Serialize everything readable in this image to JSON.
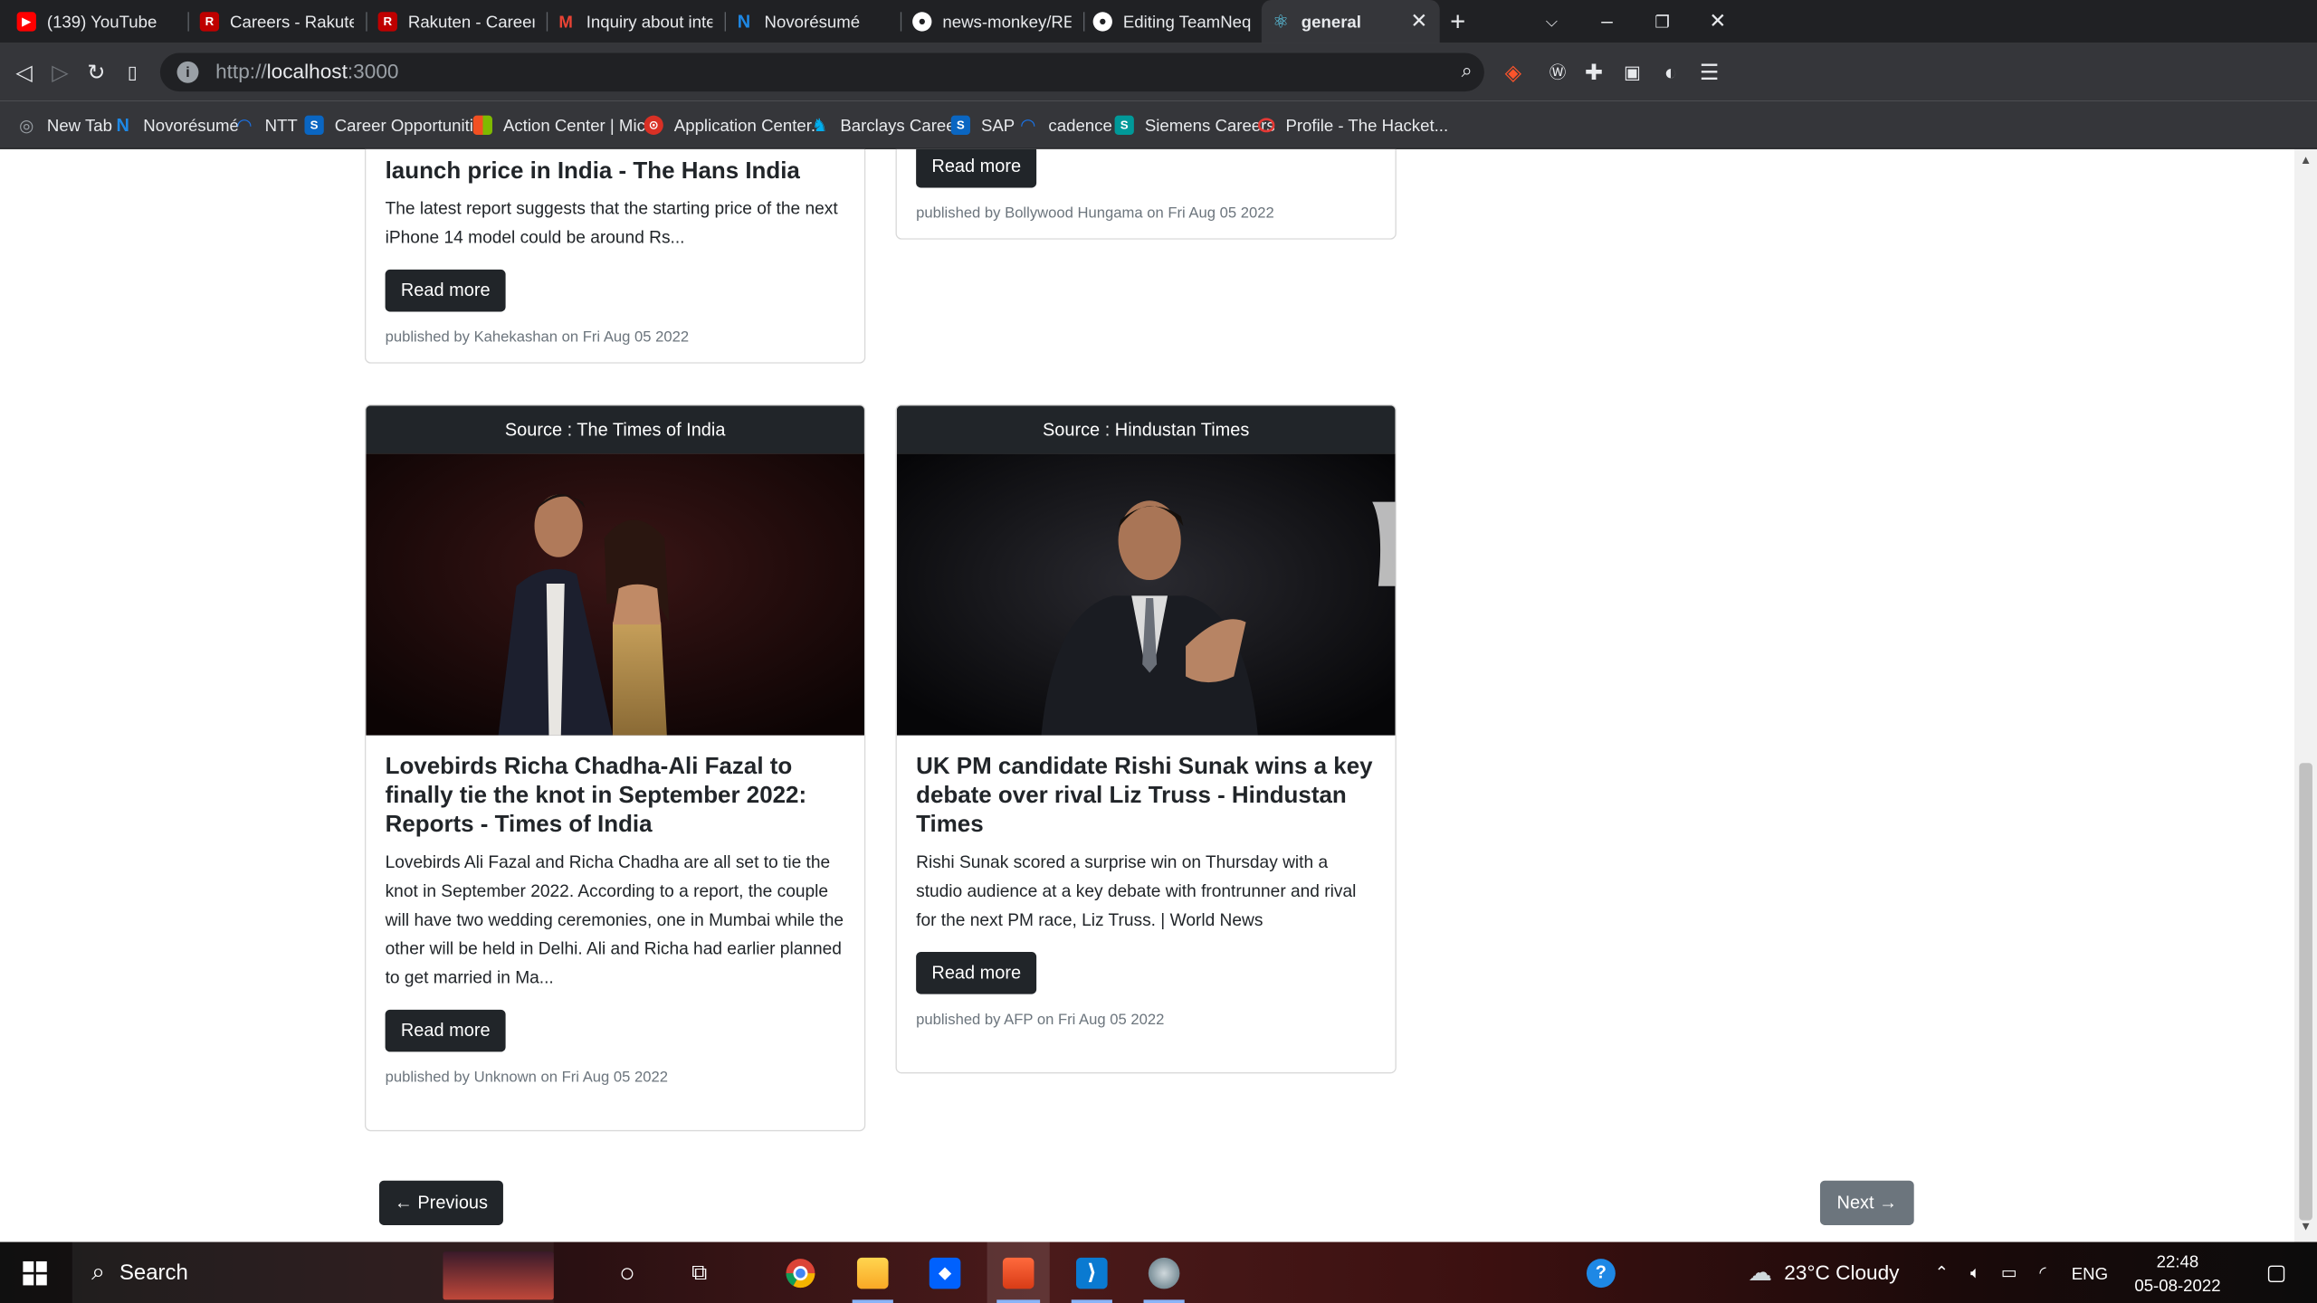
{
  "browser": {
    "tabs": [
      {
        "title": "(139) YouTube",
        "color": "#ff0000",
        "glyph": "▶"
      },
      {
        "title": "Careers - Rakuten India",
        "color": "#bf0000",
        "glyph": "R"
      },
      {
        "title": "Rakuten - Careers",
        "color": "#bf0000",
        "glyph": "R"
      },
      {
        "title": "Inquiry about internship",
        "color": "#ea4335",
        "glyph": "M"
      },
      {
        "title": "Novorésumé",
        "color": "#1e88e5",
        "glyph": "N"
      },
      {
        "title": "news-monkey/README",
        "color": "#ffffff",
        "glyph": "●"
      },
      {
        "title": "Editing TeamNequit/RE",
        "color": "#ffffff",
        "glyph": "●"
      },
      {
        "title": "general",
        "color": "#61dafb",
        "glyph": "⚛"
      }
    ],
    "active_tab_close": "✕",
    "new_tab": "+",
    "url_scheme": "http://",
    "url_host": "localhost",
    "url_port": ":3000",
    "bookmarks": [
      {
        "label": "New Tab",
        "color": "#9aa0a6",
        "glyph": "◎"
      },
      {
        "label": "Novorésumé",
        "color": "#1e88e5",
        "glyph": "N"
      },
      {
        "label": "NTT",
        "color": "#1a73e8",
        "glyph": "◠"
      },
      {
        "label": "Career Opportuniti...",
        "color": "#0a66c2",
        "glyph": "S"
      },
      {
        "label": "Action Center | Mic...",
        "color": "#f25022",
        "glyph": "▦"
      },
      {
        "label": "Application Center...",
        "color": "#d93025",
        "glyph": "⊙"
      },
      {
        "label": "Barclays Careers",
        "color": "#00aeef",
        "glyph": "♞"
      },
      {
        "label": "SAP",
        "color": "#0a66c2",
        "glyph": "S"
      },
      {
        "label": "cadence",
        "color": "#1a73e8",
        "glyph": "◠"
      },
      {
        "label": "Siemens Careers",
        "color": "#009999",
        "glyph": "S"
      },
      {
        "label": "Profile - The Hacket...",
        "color": "#e53935",
        "glyph": "◯"
      }
    ]
  },
  "cards_top": [
    {
      "title_tail": "launch price in India - The Hans India",
      "desc": "The latest report suggests that the starting price of the next iPhone 14 model could be around Rs...",
      "read_more": "Read more",
      "meta": "published by Kahekashan on Fri Aug 05 2022"
    },
    {
      "read_more": "Read more",
      "meta": "published by Bollywood Hungama on Fri Aug 05 2022"
    }
  ],
  "cards": [
    {
      "source": "Source : The Times of India",
      "title": "Lovebirds Richa Chadha-Ali Fazal to finally tie the knot in September 2022: Reports - Times of India",
      "desc": "Lovebirds Ali Fazal and Richa Chadha are all set to tie the knot in September 2022. According to a report, the couple will have two wedding ceremonies, one in Mumbai while the other will be held in Delhi. Ali and Richa had earlier planned to get married in Ma...",
      "read_more": "Read more",
      "meta": "published by Unknown on Fri Aug 05 2022"
    },
    {
      "source": "Source : Hindustan Times",
      "title": "UK PM candidate Rishi Sunak wins a key debate over rival Liz Truss - Hindustan Times",
      "desc": "Rishi Sunak scored a surprise win on Thursday with a studio audience at a key debate with frontrunner and rival for the next PM race, Liz Truss. | World News",
      "read_more": "Read more",
      "meta": "published by AFP on Fri Aug 05 2022"
    }
  ],
  "pagination": {
    "previous": "← Previous",
    "next": "Next →",
    "previous_color": "#212529",
    "next_color": "#6c757d"
  },
  "taskbar": {
    "search_label": "Search",
    "weather": "23°C  Cloudy",
    "language": "ENG",
    "time": "22:48",
    "date": "05-08-2022"
  }
}
